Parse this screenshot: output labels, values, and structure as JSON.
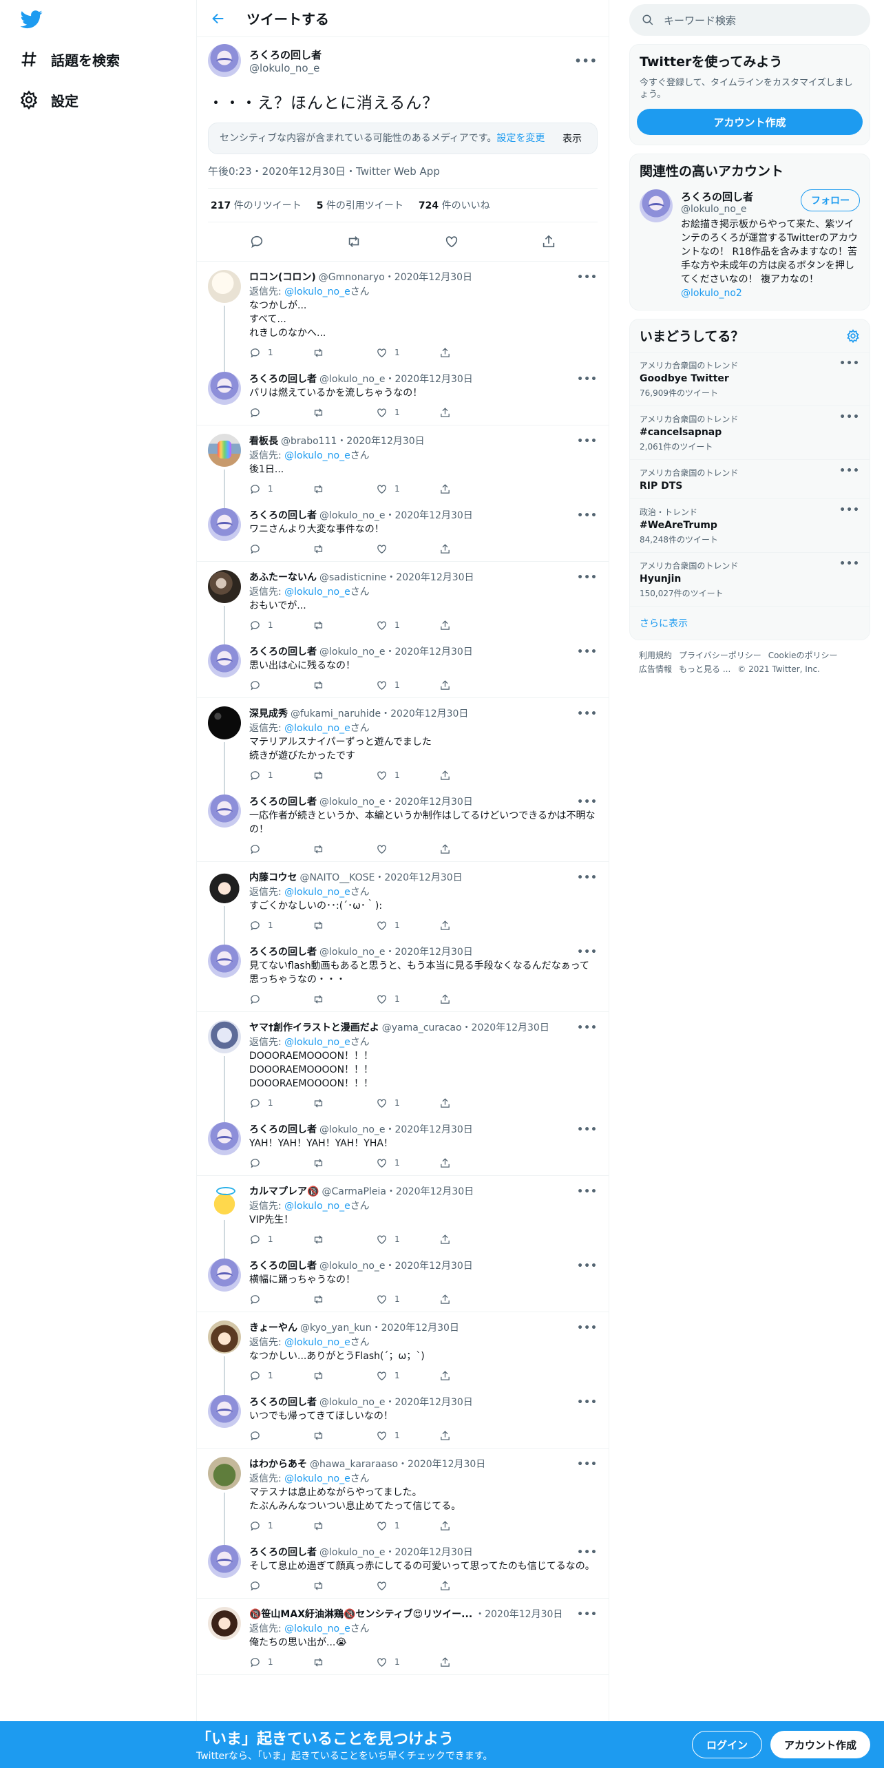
{
  "nav": {
    "explore": "話題を検索",
    "settings": "設定"
  },
  "header": {
    "title": "ツイートする"
  },
  "focal": {
    "name": "ろくろの回し者",
    "handle": "@lokulo_no_e",
    "text": "・・・え？ほんとに消えるん？",
    "sensitive_text": "センシティブな内容が含まれている可能性のあるメディアです。",
    "sensitive_link": "設定を変更",
    "show": "表示",
    "meta": "午後0:23・2020年12月30日・Twitter Web App",
    "stats": {
      "retweets": "217",
      "retweets_label": "件のリツイート",
      "quotes": "5",
      "quotes_label": "件の引用ツイート",
      "likes": "724",
      "likes_label": "件のいいね"
    }
  },
  "reply_prefix": "返信先: ",
  "reply_suffix": "さん",
  "reply_to": "@lokulo_no_e",
  "threads": [
    {
      "reply": {
        "name": "ロコン(コロン)",
        "handle": "@Gmnonaryo",
        "date": "・2020年12月30日",
        "text": "なつかしが...\nすべて...\nれきしのなかへ...",
        "replies": "1",
        "likes": "1"
      },
      "answer": {
        "name": "ろくろの回し者",
        "handle": "@lokulo_no_e",
        "date": "・2020年12月30日",
        "text": "パリは燃えているかを流しちゃうなの！",
        "replies": "",
        "likes": "1"
      }
    },
    {
      "reply": {
        "name": "看板長",
        "handle": "@brabo111",
        "date": "・2020年12月30日",
        "text": "後1日...",
        "replies": "1",
        "likes": "1"
      },
      "answer": {
        "name": "ろくろの回し者",
        "handle": "@lokulo_no_e",
        "date": "・2020年12月30日",
        "text": "ワニさんより大変な事件なの！",
        "replies": "",
        "likes": ""
      }
    },
    {
      "reply": {
        "name": "あふたーないん",
        "handle": "@sadisticnine",
        "date": "・2020年12月30日",
        "text": "おもいでが...",
        "replies": "1",
        "likes": "1"
      },
      "answer": {
        "name": "ろくろの回し者",
        "handle": "@lokulo_no_e",
        "date": "・2020年12月30日",
        "text": "思い出は心に残るなの！",
        "replies": "",
        "likes": "1"
      }
    },
    {
      "reply": {
        "name": "深見成秀",
        "handle": "@fukami_naruhide",
        "date": "・2020年12月30日",
        "text": "マテリアルスナイパーずっと遊んでました\n続きが遊びたかったです",
        "replies": "1",
        "likes": "1"
      },
      "answer": {
        "name": "ろくろの回し者",
        "handle": "@lokulo_no_e",
        "date": "・2020年12月30日",
        "text": "一応作者が続きというか、本編というか制作はしてるけどいつできるかは不明なの！",
        "replies": "",
        "likes": ""
      }
    },
    {
      "reply": {
        "name": "内藤コウセ",
        "handle": "@NAITO__KOSE",
        "date": "・2020年12月30日",
        "text": "すごくかなしいの･･:(´･ω･｀):",
        "replies": "1",
        "likes": "1"
      },
      "answer": {
        "name": "ろくろの回し者",
        "handle": "@lokulo_no_e",
        "date": "・2020年12月30日",
        "text": "見てないflash動画もあると思うと、もう本当に見る手段なくなるんだなぁって思っちゃうなの・・・",
        "replies": "",
        "likes": "1"
      }
    },
    {
      "reply": {
        "name": "ヤマ†創作イラストと漫画だよ",
        "handle": "@yama_curacao",
        "date": "・2020年12月30日",
        "text": "DOOORAEMOOOON！！！\nDOOORAEMOOOON！！！\nDOOORAEMOOOON！！！",
        "replies": "1",
        "likes": "1"
      },
      "answer": {
        "name": "ろくろの回し者",
        "handle": "@lokulo_no_e",
        "date": "・2020年12月30日",
        "text": "YAH！YAH！YAH！YAH！YHA！",
        "replies": "",
        "likes": "1"
      }
    },
    {
      "reply": {
        "name": "カルマプレア🔞",
        "handle": "@CarmaPleia",
        "date": "・2020年12月30日",
        "text": "VIP先生！",
        "replies": "1",
        "likes": "1"
      },
      "answer": {
        "name": "ろくろの回し者",
        "handle": "@lokulo_no_e",
        "date": "・2020年12月30日",
        "text": "横幅に踊っちゃうなの！",
        "replies": "",
        "likes": "1"
      }
    },
    {
      "reply": {
        "name": "きょーやん",
        "handle": "@kyo_yan_kun",
        "date": "・2020年12月30日",
        "text": "なつかしい...ありがとうFlash(´；ω；`)",
        "replies": "1",
        "likes": "1"
      },
      "answer": {
        "name": "ろくろの回し者",
        "handle": "@lokulo_no_e",
        "date": "・2020年12月30日",
        "text": "いつでも帰ってきてほしいなの！",
        "replies": "",
        "likes": "1"
      }
    },
    {
      "reply": {
        "name": "はわからあそ",
        "handle": "@hawa_kararaaso",
        "date": "・2020年12月30日",
        "text": "マテスナは息止めながらやってました。\nたぶんみんなついつい息止めてたって信じてる。",
        "replies": "1",
        "likes": "1"
      },
      "answer": {
        "name": "ろくろの回し者",
        "handle": "@lokulo_no_e",
        "date": "・2020年12月30日",
        "text": "そして息止め過ぎて顔真っ赤にしてるの可愛いって思ってたのも信じてるなの。",
        "replies": "",
        "likes": ""
      }
    },
    {
      "reply": {
        "name": "🔞笹山MAX紆油淋鶏🔞センシティブ😍リツイー...",
        "handle": "",
        "date": "・2020年12月30日",
        "text": "俺たちの思い出が...😭",
        "replies": "1",
        "likes": "1"
      },
      "answer": null
    }
  ],
  "sidebar": {
    "search_placeholder": "キーワード検索",
    "signup": {
      "title": "Twitterを使ってみよう",
      "subtitle": "今すぐ登録して、タイムラインをカスタマイズしましょう。",
      "button": "アカウント作成"
    },
    "related": {
      "title": "関連性の高いアカウント",
      "name": "ろくろの回し者",
      "handle": "@lokulo_no_e",
      "follow": "フォロー",
      "bio": "お絵描き掲示板からやって来た、紫ツインテのろくろが運営するTwitterのアカウントなの！ R18作品を含みますなの！苦手な方や未成年の方は戻るボタンを押してくださいなの！ 複アカなの！",
      "bio_link": "@lokulo_no2"
    },
    "trends": {
      "title": "いまどうしてる？",
      "items": [
        {
          "context": "アメリカ合衆国のトレンド",
          "name": "Goodbye Twitter",
          "count": "76,909件のツイート"
        },
        {
          "context": "アメリカ合衆国のトレンド",
          "name": "#cancelsapnap",
          "count": "2,061件のツイート"
        },
        {
          "context": "アメリカ合衆国のトレンド",
          "name": "RIP DTS",
          "count": ""
        },
        {
          "context": "政治・トレンド",
          "name": "#WeAreTrump",
          "count": "84,248件のツイート"
        },
        {
          "context": "アメリカ合衆国のトレンド",
          "name": "Hyunjin",
          "count": "150,027件のツイート"
        }
      ],
      "show_more": "さらに表示"
    },
    "footer": [
      "利用規約",
      "プライバシーポリシー",
      "Cookieのポリシー",
      "広告情報",
      "もっと見る ...",
      "© 2021 Twitter, Inc."
    ]
  },
  "bottom_bar": {
    "title": "「いま」起きていることを見つけよう",
    "subtitle": "Twitterなら、「いま」起きていることをいち早くチェックできます。",
    "login": "ログイン",
    "signup": "アカウント作成"
  },
  "colors": {
    "accent": "#1d9bf0",
    "text": "#0f1419",
    "muted": "#536471"
  }
}
